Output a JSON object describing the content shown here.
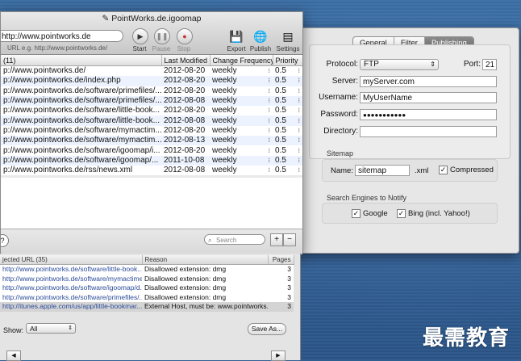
{
  "main_window": {
    "title": "PointWorks.de.igoomap",
    "url_value": "http://www.pointworks.de",
    "url_hint": "URL e.g. http://www.pointworks.de/",
    "toolbar": {
      "start": "Start",
      "pause": "Pause",
      "stop": "Stop",
      "export": "Export",
      "publish": "Publish",
      "settings": "Settings"
    },
    "columns": [
      "(11)",
      "Last Modified",
      "Change Frequency",
      "Priority"
    ],
    "rows": [
      {
        "url": "p://www.pointworks.de/",
        "modified": "2012-08-20",
        "freq": "weekly",
        "priority": "0.5"
      },
      {
        "url": "p://www.pointworks.de/index.php",
        "modified": "2012-08-20",
        "freq": "weekly",
        "priority": "0.5"
      },
      {
        "url": "p://www.pointworks.de/software/primefiles/...",
        "modified": "2012-08-20",
        "freq": "weekly",
        "priority": "0.5"
      },
      {
        "url": "p://www.pointworks.de/software/primefiles/...",
        "modified": "2012-08-08",
        "freq": "weekly",
        "priority": "0.5"
      },
      {
        "url": "p://www.pointworks.de/software/little-book...",
        "modified": "2012-08-20",
        "freq": "weekly",
        "priority": "0.5"
      },
      {
        "url": "p://www.pointworks.de/software/little-book...",
        "modified": "2012-08-08",
        "freq": "weekly",
        "priority": "0.5"
      },
      {
        "url": "p://www.pointworks.de/software/mymactim...",
        "modified": "2012-08-20",
        "freq": "weekly",
        "priority": "0.5"
      },
      {
        "url": "p://www.pointworks.de/software/mymactim...",
        "modified": "2012-08-13",
        "freq": "weekly",
        "priority": "0.5"
      },
      {
        "url": "p://www.pointworks.de/software/igoomap/i...",
        "modified": "2012-08-20",
        "freq": "weekly",
        "priority": "0.5"
      },
      {
        "url": "p://www.pointworks.de/software/igoomap/...",
        "modified": "2011-10-08",
        "freq": "weekly",
        "priority": "0.5"
      },
      {
        "url": "p://www.pointworks.de/rss/news.xml",
        "modified": "2012-08-08",
        "freq": "weekly",
        "priority": "0.5"
      }
    ],
    "search_placeholder": "Search",
    "add_label": "+",
    "remove_label": "−",
    "help_label": "?"
  },
  "rejected_panel": {
    "columns": [
      "jected URL (35)",
      "Reason",
      "Pages"
    ],
    "rows": [
      {
        "url": "http://www.pointworks.de/software/little-book...",
        "reason": "Disallowed extension: dmg",
        "pages": "3"
      },
      {
        "url": "http://www.pointworks.de/software/mymactime...",
        "reason": "Disallowed extension: dmg",
        "pages": "3"
      },
      {
        "url": "http://www.pointworks.de/software/igoomap/d...",
        "reason": "Disallowed extension: dmg",
        "pages": "3"
      },
      {
        "url": "http://www.pointworks.de/software/primefiles/...",
        "reason": "Disallowed extension: dmg",
        "pages": "3"
      },
      {
        "url": "http://itunes.apple.com/us/app/little-bookmar...",
        "reason": "External Host, must be: www.pointworks.de",
        "pages": "3"
      }
    ],
    "show_label": "Show:",
    "show_value": "All",
    "save_as_label": "Save As..."
  },
  "settings_window": {
    "tabs": [
      "General",
      "Filter",
      "Publishing"
    ],
    "active_tab": "Publishing",
    "protocol_label": "Protocol:",
    "protocol_value": "FTP",
    "port_label": "Port:",
    "port_value": "21",
    "server_label": "Server:",
    "server_value": "myServer.com",
    "username_label": "Username:",
    "username_value": "MyUserName",
    "password_label": "Password:",
    "password_value": "●●●●●●●●●●●",
    "directory_label": "Directory:",
    "directory_value": "",
    "sitemap_title": "Sitemap",
    "name_label": "Name:",
    "name_value": "sitemap",
    "ext_label": ".xml",
    "compressed_label": "Compressed",
    "engines_title": "Search Engines to Notify",
    "google_label": "Google",
    "bing_label": "Bing (incl. Yahoo!)"
  },
  "watermark": "最需教育"
}
